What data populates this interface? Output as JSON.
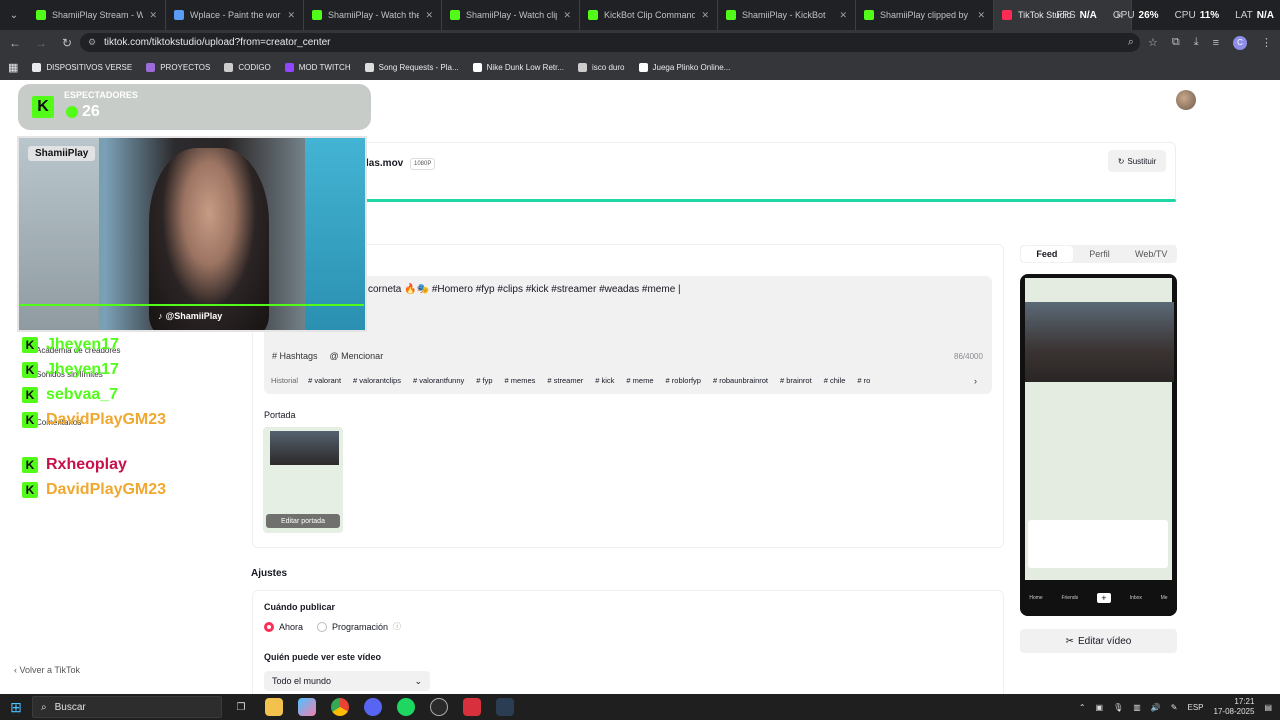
{
  "browser": {
    "tabs": [
      {
        "label": "ShamiiPlay Stream - Watc",
        "color": "#53fc18",
        "active": false
      },
      {
        "label": "Wplace - Paint the world",
        "color": "#5a9cf5",
        "active": false
      },
      {
        "label": "ShamiiPlay - Watch the V",
        "color": "#53fc18",
        "active": false
      },
      {
        "label": "ShamiiPlay - Watch clips",
        "color": "#53fc18",
        "active": false
      },
      {
        "label": "KickBot Clip Command",
        "color": "#53fc18",
        "active": false
      },
      {
        "label": "ShamiiPlay - KickBot",
        "color": "#53fc18",
        "active": false
      },
      {
        "label": "ShamiiPlay clipped by Cr",
        "color": "#53fc18",
        "active": false
      },
      {
        "label": "TikTok Studio",
        "color": "#fe2c55",
        "active": true
      }
    ],
    "perf": {
      "fps_label": "FPS",
      "fps_value": "N/A",
      "gpu_label": "GPU",
      "gpu_value": "26%",
      "cpu_label": "CPU",
      "cpu_value": "11%",
      "lat_label": "LAT",
      "lat_value": "N/A"
    },
    "url": "tiktok.com/tiktokstudio/upload?from=creator_center",
    "profile_initial": "C",
    "bookmarks": [
      {
        "label": "DISPOSITIVOS VERSE",
        "color": "#e8eaed"
      },
      {
        "label": "PROYECTOS",
        "color": "#9b6bd8"
      },
      {
        "label": "CODIGO",
        "color": "#cccccc"
      },
      {
        "label": "MOD TWITCH",
        "color": "#9146ff"
      },
      {
        "label": "Song Requests - Pla...",
        "color": "#dddddd"
      },
      {
        "label": "Nike Dunk Low Retr...",
        "color": "#ffffff"
      },
      {
        "label": "isco duro",
        "color": "#cccccc"
      },
      {
        "label": "Juega Plinko Online...",
        "color": "#ffffff"
      }
    ]
  },
  "tiktok": {
    "brand": "TikTok Studio",
    "sidebar": {
      "academy": "Academia de creadores",
      "unlimited": "Sonidos sin límites",
      "comments": "Comentarios",
      "back": "Volver a TikTok"
    },
    "upload": {
      "filename": "las.mov",
      "resolution": "1080P",
      "replace": "Sustituir"
    },
    "description": {
      "text": "corneta 🔥🎭 #Homero #fyp #clips #kick #streamer #weadas #meme |",
      "hashtags_btn": "# Hashtags",
      "mention_btn": "@ Mencionar",
      "count": "86/4000",
      "history_label": "Historial",
      "history_tags": [
        "# valorant",
        "# valorantclips",
        "# valorantfunny",
        "# fyp",
        "# memes",
        "# streamer",
        "# kick",
        "# meme",
        "# roblorfyp",
        "# robaunbrainrot",
        "# brainrot",
        "# chile",
        "# ro"
      ]
    },
    "cover": {
      "label": "Portada",
      "edit": "Editar portada"
    },
    "settings": {
      "title": "Ajustes",
      "when_label": "Cuándo publicar",
      "now": "Ahora",
      "schedule": "Programación",
      "who_label": "Quién puede ver este vídeo",
      "who_value": "Todo el mundo"
    },
    "preview": {
      "tabs": [
        "Feed",
        "Perfil",
        "Web/TV"
      ],
      "edit_video": "Editar vídeo",
      "phone_nav": [
        "Home",
        "Friends",
        "",
        "Inbox",
        "Me"
      ]
    }
  },
  "overlay": {
    "viewers_label": "ESPECTADORES",
    "viewers_count": "26",
    "streamer_name": "ShamiiPlay",
    "handle": "@ShamiiPlay",
    "chat": [
      {
        "user": "Jheyen17",
        "color": "#53fc18"
      },
      {
        "user": "Jheyen17",
        "color": "#53fc18"
      },
      {
        "user": "sebvaa_7",
        "color": "#53fc18"
      },
      {
        "user": "DavidPlayGM23",
        "color": "#f0a830"
      },
      {
        "user": "Rxheoplay",
        "color": "#c8104a"
      },
      {
        "user": "DavidPlayGM23",
        "color": "#f0a830"
      }
    ]
  },
  "taskbar": {
    "search": "Buscar",
    "lang": "ESP",
    "time": "17:21",
    "date": "17-08-2025"
  }
}
